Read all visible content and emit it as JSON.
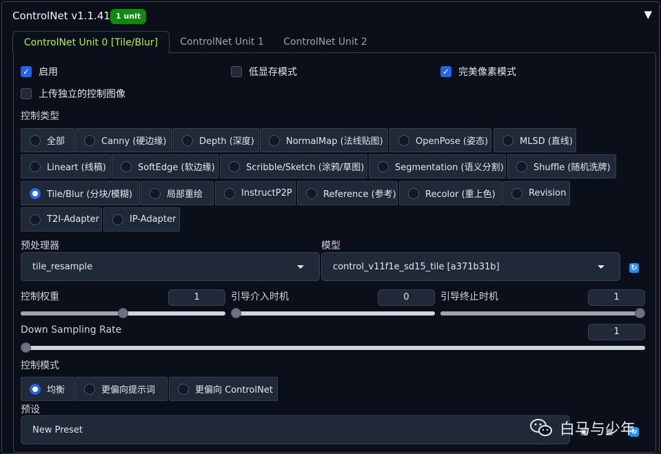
{
  "header": {
    "title": "ControlNet v1.1.410",
    "badge": "1 unit",
    "collapse_icon": "triangle-down-icon"
  },
  "tabs": [
    {
      "label": "ControlNet Unit 0 [Tile/Blur]",
      "active": true
    },
    {
      "label": "ControlNet Unit 1",
      "active": false
    },
    {
      "label": "ControlNet Unit 2",
      "active": false
    }
  ],
  "options": {
    "enable": {
      "label": "启用",
      "checked": true
    },
    "low_vram": {
      "label": "低显存模式",
      "checked": false
    },
    "pixel_perfect": {
      "label": "完美像素模式",
      "checked": true
    },
    "upload_independent": {
      "label": "上传独立的控制图像",
      "checked": false
    }
  },
  "control_type": {
    "label": "控制类型",
    "selected": "Tile/Blur (分块/模糊)",
    "items": [
      "全部",
      "Canny (硬边缘)",
      "Depth (深度)",
      "NormalMap (法线贴图)",
      "OpenPose (姿态)",
      "MLSD (直线)",
      "Lineart (线稿)",
      "SoftEdge (软边缘)",
      "Scribble/Sketch (涂鸦/草图)",
      "Segmentation (语义分割)",
      "Shuffle (随机洗牌)",
      "Tile/Blur (分块/模糊)",
      "局部重绘",
      "InstructP2P",
      "Reference (参考)",
      "Recolor (重上色)",
      "Revision",
      "T2I-Adapter",
      "IP-Adapter"
    ]
  },
  "preprocessor": {
    "label": "预处理器",
    "value": "tile_resample"
  },
  "model": {
    "label": "模型",
    "value": "control_v11f1e_sd15_tile [a371b31b]",
    "refresh_icon": "refresh-icon"
  },
  "sliders": {
    "weight": {
      "label": "控制权重",
      "value": "1",
      "fraction": 0.5
    },
    "start": {
      "label": "引导介入时机",
      "value": "0",
      "fraction": 0.0
    },
    "end": {
      "label": "引导终止时机",
      "value": "1",
      "fraction": 1.0
    },
    "down_sampling": {
      "label": "Down Sampling Rate",
      "value": "1",
      "fraction": 0.0
    }
  },
  "control_mode": {
    "label": "控制模式",
    "selected": "均衡",
    "items": [
      "均衡",
      "更偏向提示词",
      "更偏向 ControlNet"
    ]
  },
  "preset": {
    "label": "预设",
    "value": "New Preset"
  },
  "watermark": {
    "text": "白马与少年",
    "icon": "wechat-icon"
  },
  "colors": {
    "accent": "#2563eb",
    "tab_active": "#b5f04a",
    "badge": "#0f8a0f",
    "bg": "#0b0f19"
  }
}
